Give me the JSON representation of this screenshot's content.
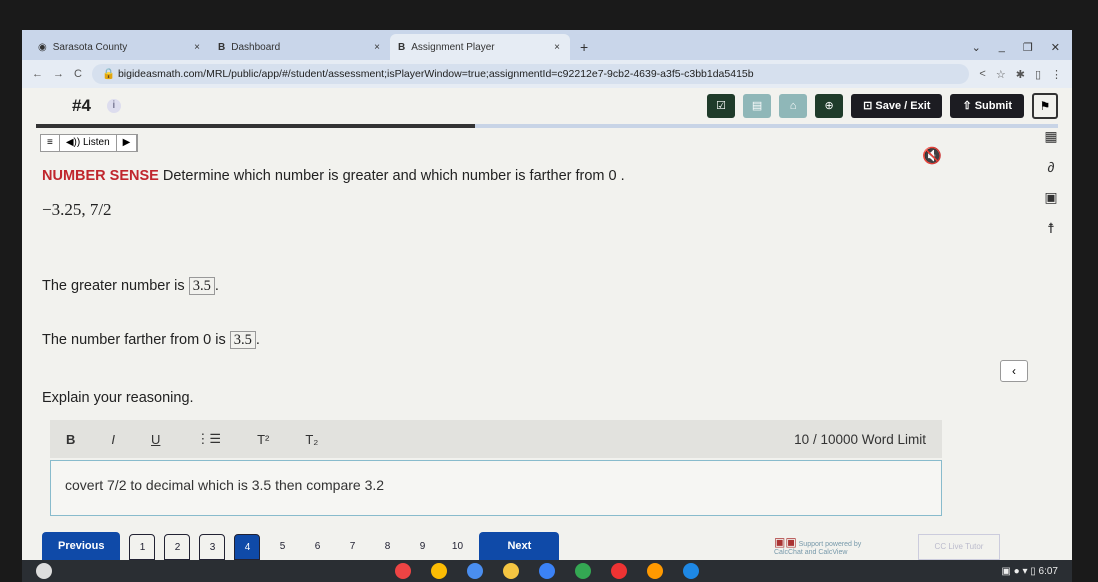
{
  "browser": {
    "tabs": [
      {
        "label": "Sarasota County"
      },
      {
        "label": "Dashboard"
      },
      {
        "label": "Assignment Player"
      }
    ],
    "url": "bigideasmath.com/MRL/public/app/#/student/assessment;isPlayerWindow=true;assignmentId=c92212e7-9cb2-4639-a3f5-c3bb1da5415b"
  },
  "header": {
    "question_number": "#4",
    "info": "i",
    "save_exit": "Save / Exit",
    "submit": "Submit",
    "progress_percent": 43
  },
  "listen": {
    "label": "◀)) Listen"
  },
  "question": {
    "tag": "NUMBER SENSE",
    "prompt": "Determine which number is greater and which number is farther from 0 .",
    "numbers": "−3.25, 7/2",
    "greater_label": "The greater number is",
    "greater_value": "3.5",
    "farther_label": "The number farther from 0 is",
    "farther_value": "3.5",
    "explain": "Explain your reasoning."
  },
  "editor": {
    "bold": "B",
    "italic": "I",
    "underline": "U",
    "list": "⋮☰",
    "sup": "T²",
    "sub": "T₂",
    "limit": "10 / 10000 Word Limit",
    "text": "covert 7/2 to decimal which is 3.5 then compare 3.2"
  },
  "nav": {
    "previous": "Previous",
    "next": "Next",
    "pages": [
      "1",
      "2",
      "3",
      "4",
      "5",
      "6",
      "7",
      "8",
      "9",
      "10"
    ],
    "current": "4"
  },
  "footer": {
    "support": "Support powered by CalcChat and CalcView",
    "live_tutor": "CC Live Tutor"
  },
  "taskbar": {
    "time": "6:07"
  }
}
